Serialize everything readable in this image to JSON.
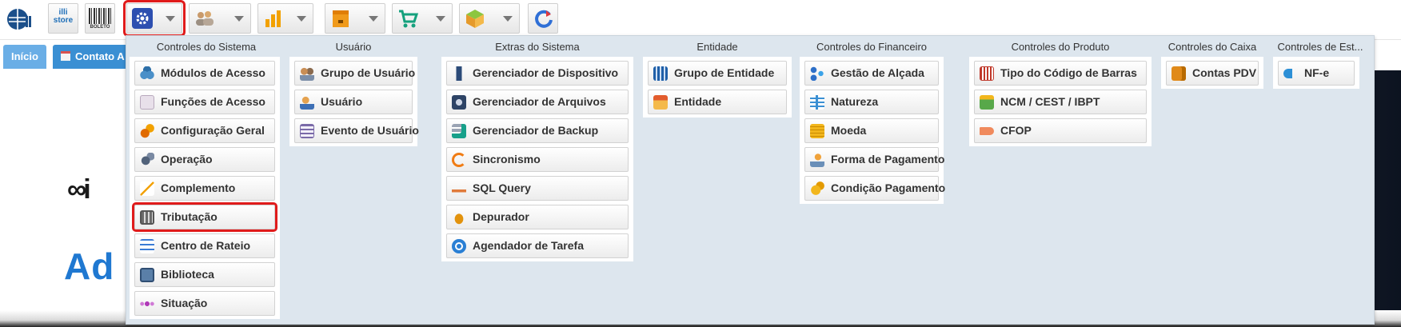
{
  "toolbar": {
    "items": [
      {
        "icon": "app-logo-icon"
      },
      {
        "icon": "illi-store-icon",
        "text": "illi store"
      },
      {
        "icon": "boleto-barcode-icon",
        "text": "BOLETO"
      },
      {
        "icon": "gear-icon",
        "has_caret": true,
        "selected": true
      },
      {
        "icon": "users-icon",
        "has_caret": true
      },
      {
        "icon": "bar-chart-icon",
        "has_caret": true
      },
      {
        "icon": "box-icon",
        "has_caret": true
      },
      {
        "icon": "cart-icon",
        "has_caret": true
      },
      {
        "icon": "package-icon",
        "has_caret": true
      },
      {
        "icon": "sync-icon"
      }
    ]
  },
  "tabs": {
    "inicio": "Início",
    "contato": "Contato A"
  },
  "menu": {
    "columns": [
      {
        "title": "Controles do Sistema",
        "items": [
          {
            "label": "Módulos de Acesso",
            "icon": "modules-icon"
          },
          {
            "label": "Funções de Acesso",
            "icon": "functions-icon"
          },
          {
            "label": "Configuração Geral",
            "icon": "gears-icon"
          },
          {
            "label": "Operação",
            "icon": "operation-icon"
          },
          {
            "label": "Complemento",
            "icon": "complement-icon"
          },
          {
            "label": "Tributação",
            "icon": "calculator-icon",
            "selected": true
          },
          {
            "label": "Centro de Rateio",
            "icon": "checklist-icon"
          },
          {
            "label": "Biblioteca",
            "icon": "library-icon"
          },
          {
            "label": "Situação",
            "icon": "status-icon"
          }
        ]
      },
      {
        "title": "Usuário",
        "items": [
          {
            "label": "Grupo de Usuário",
            "icon": "user-group-icon"
          },
          {
            "label": "Usuário",
            "icon": "user-icon"
          },
          {
            "label": "Evento de Usuário",
            "icon": "event-list-icon"
          }
        ]
      },
      {
        "title": "Extras do Sistema",
        "items": [
          {
            "label": "Gerenciador de Dispositivo",
            "icon": "device-icon"
          },
          {
            "label": "Gerenciador de Arquivos",
            "icon": "file-manager-icon"
          },
          {
            "label": "Gerenciador de Backup",
            "icon": "backup-icon"
          },
          {
            "label": "Sincronismo",
            "icon": "sync-icon"
          },
          {
            "label": "SQL Query",
            "icon": "mysql-icon"
          },
          {
            "label": "Depurador",
            "icon": "bug-icon"
          },
          {
            "label": "Agendador de Tarefa",
            "icon": "task-scheduler-icon"
          }
        ]
      },
      {
        "title": "Entidade",
        "items": [
          {
            "label": "Grupo de Entidade",
            "icon": "building-icon"
          },
          {
            "label": "Entidade",
            "icon": "store-icon"
          }
        ]
      },
      {
        "title": "Controles do Financeiro",
        "items": [
          {
            "label": "Gestão de Alçada",
            "icon": "hierarchy-icon"
          },
          {
            "label": "Natureza",
            "icon": "nature-tree-icon"
          },
          {
            "label": "Moeda",
            "icon": "coins-icon"
          },
          {
            "label": "Forma de Pagamento",
            "icon": "payment-icon"
          },
          {
            "label": "Condição Pagamento",
            "icon": "coin-condition-icon"
          }
        ]
      },
      {
        "title": "Controles do Produto",
        "items": [
          {
            "label": "Tipo do Código de Barras",
            "icon": "barcode-icon"
          },
          {
            "label": "NCM / CEST / IBPT",
            "icon": "money-icon"
          },
          {
            "label": "CFOP",
            "icon": "tag-icon"
          }
        ]
      },
      {
        "title": "Controles do Caixa",
        "items": [
          {
            "label": "Contas PDV",
            "icon": "wallet-icon"
          }
        ]
      },
      {
        "title": "Controles de Est...",
        "items": [
          {
            "label": "NF-e",
            "icon": "nfe-icon"
          }
        ]
      }
    ]
  },
  "background": {
    "brand_fragment": "∞i",
    "heading_fragment": "Ad"
  },
  "colors": {
    "accent_blue": "#3a8fd3",
    "highlight_red": "#e01b1b",
    "menu_bg": "#dde6ee"
  }
}
